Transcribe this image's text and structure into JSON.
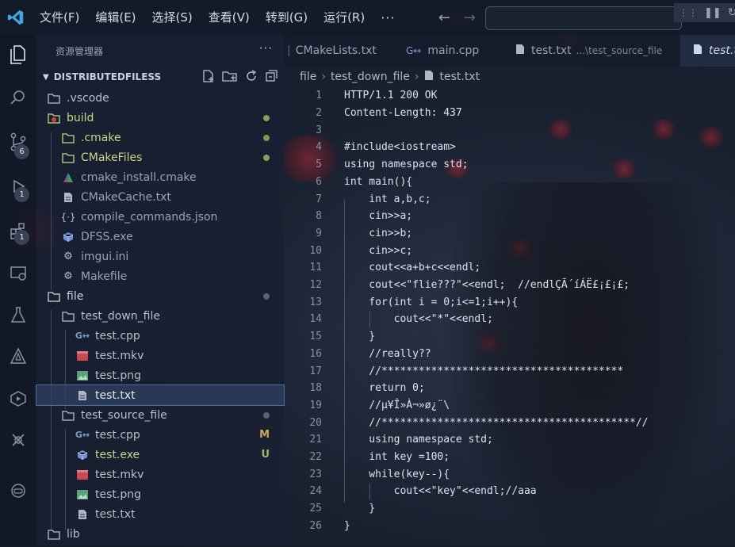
{
  "titlebar": {
    "menus": [
      "文件(F)",
      "编辑(E)",
      "选择(S)",
      "查看(V)",
      "转到(G)",
      "运行(R)"
    ],
    "more": "···",
    "accent": "#3ea6e0"
  },
  "activity": {
    "badges": [
      "6",
      "1",
      "1"
    ]
  },
  "sidebar": {
    "header": "资源管理器",
    "more": "···",
    "project": "DISTRIBUTEDFILESS",
    "tree": [
      {
        "label": "vscode",
        "display": ".vscode",
        "icon": "folder-icon",
        "color": "#b8bfcd"
      },
      {
        "label": "build",
        "display": "build",
        "icon": "folder-icon",
        "color": "#c9d68a",
        "dot": "#8d9a5a"
      },
      {
        "label": "cmake",
        "display": ".cmake",
        "icon": "folder-icon",
        "color": "#c9d68a",
        "dot": "#6fa150"
      },
      {
        "label": "CMakeFiles",
        "display": "CMakeFiles",
        "icon": "folder-icon",
        "color": "#c9d68a",
        "dot": "#8d9a5a"
      },
      {
        "label": "cmake_install.cmake",
        "display": "cmake_install.cmake",
        "icon": "cmake-icon",
        "color": "#9aa3b6"
      },
      {
        "label": "CMakeCache.txt",
        "display": "CMakeCache.txt",
        "icon": "text-file-icon",
        "color": "#9aa3b6"
      },
      {
        "label": "compile_commands.json",
        "display": "compile_commands.json",
        "icon": "json-icon",
        "color": "#9aa3b6"
      },
      {
        "label": "DFSS.exe",
        "display": "DFSS.exe",
        "icon": "exe-icon",
        "color": "#9aa3b6"
      },
      {
        "label": "imgui.ini",
        "display": "imgui.ini",
        "icon": "gear-icon",
        "color": "#9aa3b6"
      },
      {
        "label": "Makefile",
        "display": "Makefile",
        "icon": "gear-icon",
        "color": "#9aa3b6"
      },
      {
        "label": "file",
        "display": "file",
        "icon": "folder-icon",
        "color": "#cfd6e4",
        "dot": "#5a6275"
      },
      {
        "label": "test_down_file",
        "display": "test_down_file",
        "icon": "folder-icon",
        "color": "#b8bfcd"
      },
      {
        "label": "test.cpp",
        "display": "test.cpp",
        "icon": "cpp-icon",
        "color": "#b8bfcd"
      },
      {
        "label": "test.mkv",
        "display": "test.mkv",
        "icon": "video-icon",
        "color": "#b8bfcd"
      },
      {
        "label": "test.png",
        "display": "test.png",
        "icon": "image-icon",
        "color": "#b8bfcd"
      },
      {
        "label": "test.txt",
        "display": "test.txt",
        "icon": "text-file-icon",
        "color": "#e3e7ef",
        "selected": true
      },
      {
        "label": "test_source_file",
        "display": "test_source_file",
        "icon": "folder-icon",
        "color": "#b8bfcd",
        "dot": "#5a6275"
      },
      {
        "label": "test.cpp",
        "display": "test.cpp",
        "icon": "cpp-icon",
        "color": "#b8bfcd",
        "status": "M",
        "statusColor": "#c9a85c"
      },
      {
        "label": "test.exe",
        "display": "test.exe",
        "icon": "exe-icon",
        "color": "#c9d68a",
        "status": "U",
        "statusColor": "#8fbf6a"
      },
      {
        "label": "test.mkv",
        "display": "test.mkv",
        "icon": "video-icon",
        "color": "#b8bfcd"
      },
      {
        "label": "test.png",
        "display": "test.png",
        "icon": "image-icon",
        "color": "#b8bfcd"
      },
      {
        "label": "test.txt",
        "display": "test.txt",
        "icon": "text-file-icon",
        "color": "#b8bfcd"
      },
      {
        "label": "lib",
        "display": "lib",
        "icon": "folder-icon",
        "color": "#b8bfcd"
      }
    ]
  },
  "tabs": [
    {
      "label": "CMakeLists.txt",
      "sub": ""
    },
    {
      "label": "main.cpp",
      "sub": ""
    },
    {
      "label": "test.txt",
      "sub": "...\\test_source_file"
    },
    {
      "label": "test.txt",
      "sub": ""
    }
  ],
  "breadcrumbs": [
    "file",
    "test_down_file",
    "test.txt"
  ],
  "code": [
    "HTTP/1.1 200 OK",
    "Content-Length: 437",
    "",
    "#include<iostream>",
    "using namespace std;",
    "int main(){",
    "    int a,b,c;",
    "    cin>>a;",
    "    cin>>b;",
    "    cin>>c;",
    "    cout<<a+b+c<<endl;",
    "    cout<<\"flie???\"<<endl;  //endlÇÃ´íÁË£¡£¡£;",
    "    for(int i = 0;i<=1;i++){",
    "        cout<<\"*\"<<endl;",
    "    }",
    "    //really??",
    "    //***************************************",
    "    return 0;",
    "    //µ¥Î»À¬»ø¿¨\\",
    "    //*****************************************//",
    "    using namespace std;",
    "    int key =100;",
    "    while(key--){",
    "        cout<<\"key\"<<endl;//aaa",
    "    }",
    "}"
  ]
}
